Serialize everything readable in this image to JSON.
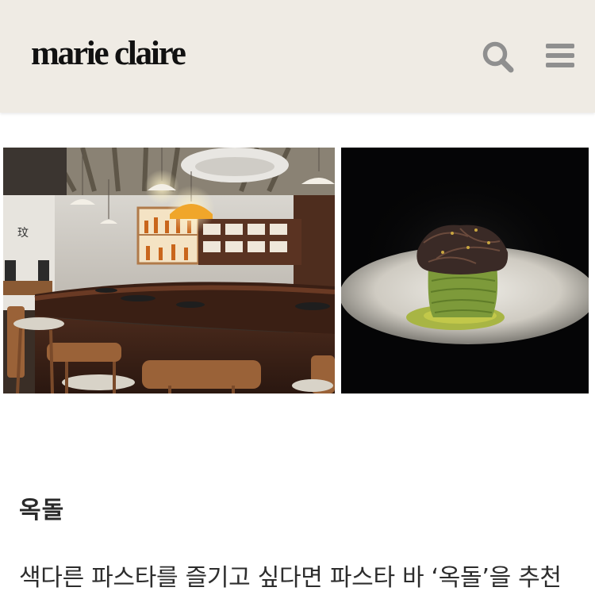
{
  "header": {
    "logo_text": "marie claire",
    "search_icon": "search-icon",
    "menu_icon": "menu-icon",
    "background_color": "#efebe4"
  },
  "gallery": {
    "images": [
      {
        "description_name": "restaurant-bar-interior-photo"
      },
      {
        "description_name": "green-pasta-dish-photo"
      }
    ]
  },
  "article": {
    "venue_name": "옥돌",
    "paragraph": "색다른 파스타를 즐기고 싶다면 파스타 바 ‘옥돌’을 추천"
  }
}
